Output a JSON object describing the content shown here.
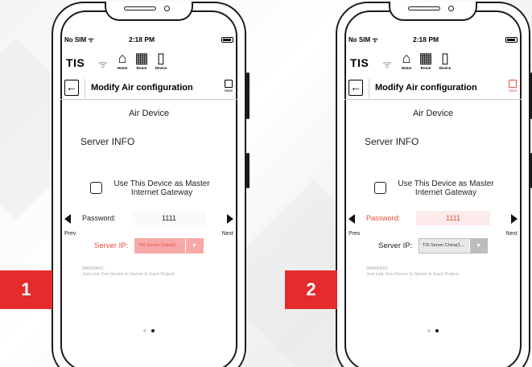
{
  "status": {
    "carrier": "No SIM",
    "time": "2:18 PM"
  },
  "header": {
    "logo": "TIS",
    "nav": [
      {
        "label": "Home",
        "icon": "home-icon"
      },
      {
        "label": "Room",
        "icon": "room-grid-icon"
      },
      {
        "label": "Device",
        "icon": "device-icon"
      }
    ]
  },
  "titlebar": {
    "title": "Modify Air configuration",
    "save_label": "Save"
  },
  "content": {
    "device_title": "Air Device",
    "section_title": "Server INFO",
    "gateway_label": "Use This Device as Master Internet Gateway",
    "password_label": "Password:",
    "password_value": "1111",
    "prev_label": "Prev",
    "next_label": "Next",
    "server_ip_label": "Server IP:",
    "server_ip_value": "TIS Server China(1...",
    "warning_title": "WARNING:",
    "warning_text": "Just Link One Device to Server In Each Project."
  },
  "steps": [
    "1",
    "2"
  ],
  "colors": {
    "highlight": "#e74c3c",
    "badge": "#e52b2b",
    "ip_highlight_bg": "#f7a8a8"
  }
}
